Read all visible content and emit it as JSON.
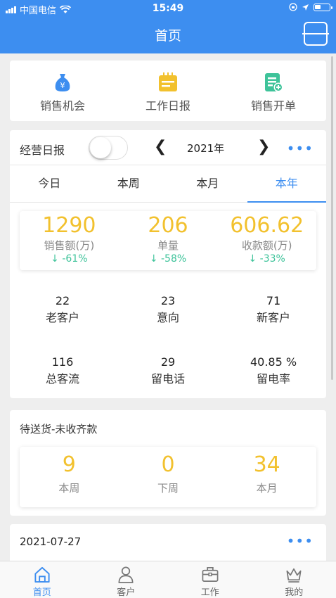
{
  "status_bar": {
    "carrier": "中国电信",
    "time": "15:49"
  },
  "nav": {
    "title": "首页",
    "scan_icon": "scan-icon"
  },
  "quick_actions": [
    {
      "label": "销售机会",
      "icon": "money-bag-icon",
      "color": "#3d8ef0"
    },
    {
      "label": "工作日报",
      "icon": "notepad-icon",
      "color": "#f2c12e"
    },
    {
      "label": "销售开单",
      "icon": "add-document-icon",
      "color": "#3ec39a"
    }
  ],
  "report": {
    "title": "经营日报",
    "toggle_on": false,
    "year_label": "2021年",
    "more": "•••",
    "tabs": [
      "今日",
      "本周",
      "本月",
      "本年"
    ],
    "active_tab": 3,
    "metrics": [
      {
        "value": "1290",
        "label": "销售额(万)",
        "change": "↓ -61%"
      },
      {
        "value": "206",
        "label": "单量",
        "change": "↓ -58%"
      },
      {
        "value": "606.62",
        "label": "收款额(万)",
        "change": "↓ -33%"
      }
    ],
    "stats_row1": [
      {
        "value": "22",
        "label": "老客户"
      },
      {
        "value": "23",
        "label": "意向"
      },
      {
        "value": "71",
        "label": "新客户"
      }
    ],
    "stats_row2": [
      {
        "value": "116",
        "label": "总客流"
      },
      {
        "value": "29",
        "label": "留电话"
      },
      {
        "value": "40.85 %",
        "label": "留电率"
      }
    ]
  },
  "pending": {
    "title": "待送货-未收齐款",
    "items": [
      {
        "value": "9",
        "label": "本周"
      },
      {
        "value": "0",
        "label": "下周"
      },
      {
        "value": "34",
        "label": "本月"
      }
    ]
  },
  "date_card": {
    "date": "2021-07-27",
    "more": "•••"
  },
  "tabbar": [
    {
      "label": "首页",
      "icon": "home-icon",
      "active": true
    },
    {
      "label": "客户",
      "icon": "person-icon",
      "active": false
    },
    {
      "label": "工作",
      "icon": "briefcase-icon",
      "active": false
    },
    {
      "label": "我的",
      "icon": "crown-icon",
      "active": false
    }
  ],
  "colors": {
    "primary": "#3d8ef0",
    "highlight": "#f2c12e",
    "positive": "#3ec39a"
  }
}
